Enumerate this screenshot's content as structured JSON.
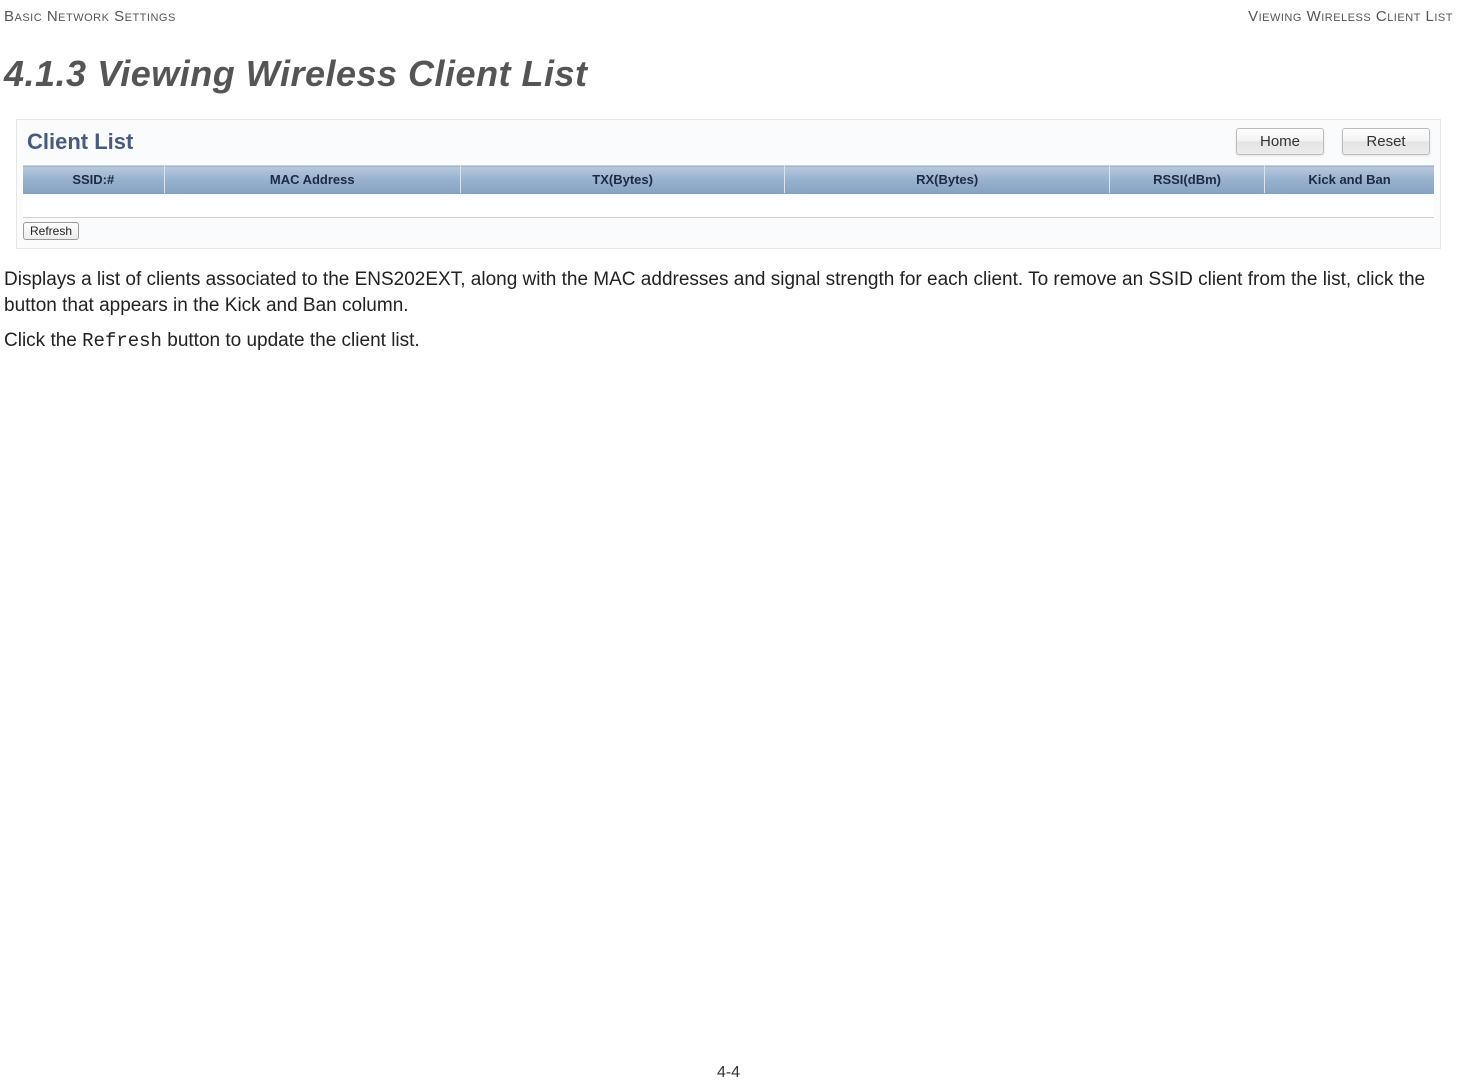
{
  "header": {
    "left": "Basic Network Settings",
    "right": "Viewing Wireless Client List"
  },
  "section": {
    "number": "4.1.3",
    "title": "Viewing Wireless Client List"
  },
  "panel": {
    "title": "Client List",
    "buttons": {
      "home": "Home",
      "reset": "Reset"
    },
    "columns": {
      "ssid": "SSID:#",
      "mac": "MAC Address",
      "tx": "TX(Bytes)",
      "rx": "RX(Bytes)",
      "rssi": "RSSI(dBm)",
      "kick": "Kick and Ban"
    },
    "refresh": "Refresh"
  },
  "body": {
    "p1": "Displays a list of clients associated to the ENS202EXT, along with the MAC addresses and signal strength for each client. To remove an SSID client from the list, click the button that appears in the Kick and Ban column.",
    "p2a": "Click the ",
    "p2b": "Refresh",
    "p2c": " button to update the client list."
  },
  "footer": {
    "page": "4-4"
  }
}
